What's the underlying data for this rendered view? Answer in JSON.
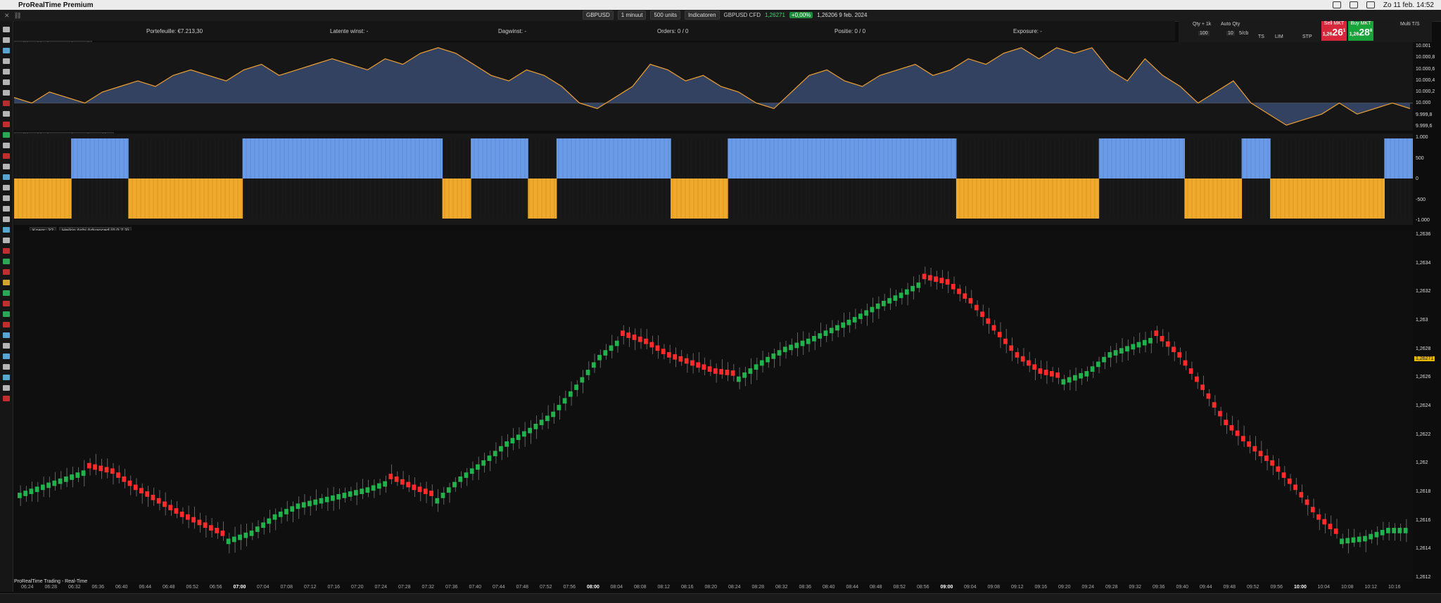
{
  "menubar": {
    "app_title": "ProRealTime Premium",
    "datetime": "Zo 11 feb. 14:52"
  },
  "toolbar": {
    "instrument": "GBPUSD",
    "timeframe": "1 minuut",
    "units": "500 units",
    "indicators": "Indicatoren",
    "instrument_info": "GBPUSD CFD",
    "last_price": "1,26271",
    "change": "+0,00%",
    "quote_info": "1,26206 9 feb. 2024"
  },
  "infobar": {
    "portfolio": "Portefeuille: €7.213,30",
    "latent": "Latente winst: -",
    "daily": "Dagwinst: -",
    "orders": "Orders: 0",
    "orders_sep": "/ 0",
    "position": "Positie: 0",
    "position_sep": "/ 0",
    "exposure": "Exposure: -"
  },
  "order_panel": {
    "qty_label": "Qty + 1k",
    "autoqty_label": "Auto Qty",
    "qty_value": "100",
    "qty_value2": "10",
    "spinner": "5/cb",
    "ts_label": "TS",
    "lim_label": "LIM",
    "stp_label": "STP",
    "multi_label": "Multi T/S",
    "sell_label": "Sell MKT",
    "sell_prefix": "1,26",
    "sell_big": "26",
    "sell_sup": "1",
    "buy_label": "Buy MKT",
    "buy_prefix": "1,26",
    "buy_big": "28",
    "buy_sup": "8"
  },
  "panels": {
    "top_label": "Heikin Ashi Adv. System (0 0 7 3)",
    "mid_label": "Heikin Ashi Adv. System (0 0 7 3) - Posities",
    "main_label_1": "Koers: 32",
    "main_label_2": "Heikin Ashi Advanced (0 0 7 3)"
  },
  "top_axis": [
    "10.001",
    "10.000,8",
    "10.000,6",
    "10.000,4",
    "10.000,2",
    "10.000",
    "9.999,8",
    "9.999,6"
  ],
  "mid_axis": [
    "1.000",
    "500",
    "0",
    "-500",
    "-1.000"
  ],
  "main_axis": [
    "1,2636",
    "1,2634",
    "1,2632",
    "1,263",
    "1,2628",
    "1,2626",
    "1,2624",
    "1,2622",
    "1,262",
    "1,2618",
    "1,2616",
    "1,2614",
    "1,2612"
  ],
  "price_tag": "1,26271",
  "x_axis": [
    "06:24",
    "06:28",
    "06:32",
    "06:36",
    "06:40",
    "06:44",
    "06:48",
    "06:52",
    "06:56",
    "07:00",
    "07:04",
    "07:08",
    "07:12",
    "07:16",
    "07:20",
    "07:24",
    "07:28",
    "07:32",
    "07:36",
    "07:40",
    "07:44",
    "07:48",
    "07:52",
    "07:56",
    "08:00",
    "08:04",
    "08:08",
    "08:12",
    "08:16",
    "08:20",
    "08:24",
    "08:28",
    "08:32",
    "08:36",
    "08:40",
    "08:44",
    "08:48",
    "08:52",
    "08:56",
    "09:00",
    "09:04",
    "09:08",
    "09:12",
    "09:16",
    "09:20",
    "09:24",
    "09:28",
    "09:32",
    "09:36",
    "09:40",
    "09:44",
    "09:48",
    "09:52",
    "09:56",
    "10:00",
    "10:04",
    "10:08",
    "10:12",
    "10:16"
  ],
  "footer": "ProRealTime Trading - Real-Time",
  "colors": {
    "bull": "#22b24c",
    "bear": "#ff2a2a",
    "long": "#6a9be8",
    "short": "#f0a92a",
    "equity_line": "#f0a030",
    "equity_fill": "#3a4a6e"
  },
  "chart_data": [
    {
      "type": "area",
      "series": [
        {
          "name": "Heikin Ashi Adv. System (0 0 7 3)",
          "values": [
            10000.1,
            10000.0,
            10000.2,
            10000.1,
            10000.0,
            10000.2,
            10000.3,
            10000.4,
            10000.3,
            10000.5,
            10000.6,
            10000.5,
            10000.4,
            10000.6,
            10000.7,
            10000.5,
            10000.6,
            10000.7,
            10000.8,
            10000.7,
            10000.6,
            10000.8,
            10000.7,
            10000.9,
            10001.0,
            10000.9,
            10000.7,
            10000.5,
            10000.4,
            10000.6,
            10000.5,
            10000.3,
            10000.0,
            9999.9,
            10000.1,
            10000.3,
            10000.7,
            10000.6,
            10000.4,
            10000.5,
            10000.3,
            10000.2,
            10000.0,
            9999.9,
            10000.2,
            10000.5,
            10000.6,
            10000.4,
            10000.3,
            10000.5,
            10000.6,
            10000.7,
            10000.5,
            10000.6,
            10000.8,
            10000.7,
            10000.9,
            10001.0,
            10000.8,
            10001.0,
            10000.9,
            10001.0,
            10000.6,
            10000.4,
            10000.8,
            10000.5,
            10000.3,
            10000.0,
            10000.2,
            10000.4,
            10000.0,
            9999.8,
            9999.6,
            9999.7,
            9999.8,
            10000.0,
            9999.8,
            9999.9,
            10000.0,
            9999.9
          ]
        }
      ],
      "ylim": [
        9999.5,
        10001.1
      ]
    },
    {
      "type": "bar",
      "series": [
        {
          "name": "Heikin Ashi Adv. System (0 0 7 3) - Posities",
          "values": [
            -1000,
            -1000,
            1000,
            1000,
            -1000,
            -1000,
            -1000,
            -1000,
            1000,
            1000,
            1000,
            1000,
            1000,
            1000,
            1000,
            -1000,
            1000,
            1000,
            -1000,
            1000,
            1000,
            1000,
            1000,
            -1000,
            -1000,
            1000,
            1000,
            1000,
            1000,
            1000,
            1000,
            1000,
            1000,
            -1000,
            -1000,
            -1000,
            -1000,
            -1000,
            1000,
            1000,
            1000,
            -1000,
            -1000,
            1000,
            -1000,
            -1000,
            -1000,
            -1000,
            1000
          ]
        }
      ],
      "ylim": [
        -1000,
        1000
      ]
    },
    {
      "type": "candlestick",
      "series": [
        {
          "name": "Koers",
          "values": [
            1.26176,
            1.26182,
            1.26188,
            1.26194,
            1.2619,
            1.26178,
            1.26168,
            1.26158,
            1.2615,
            1.26142,
            1.26148,
            1.2616,
            1.26168,
            1.26172,
            1.26176,
            1.2618,
            1.26186,
            1.26178,
            1.26172,
            1.26188,
            1.262,
            1.26214,
            1.26224,
            1.26236,
            1.26256,
            1.26278,
            1.26292,
            1.26286,
            1.26276,
            1.2627,
            1.26264,
            1.26262,
            1.26274,
            1.26284,
            1.2629,
            1.26298,
            1.26306,
            1.26316,
            1.26324,
            1.26334,
            1.2633,
            1.26316,
            1.26296,
            1.26276,
            1.26264,
            1.2626,
            1.26266,
            1.2628,
            1.26286,
            1.26292,
            1.26276,
            1.26252,
            1.26226,
            1.2621,
            1.26196,
            1.26178,
            1.26156,
            1.26142,
            1.26144,
            1.2615
          ]
        }
      ],
      "ylim": [
        1.2611,
        1.2637
      ]
    }
  ]
}
